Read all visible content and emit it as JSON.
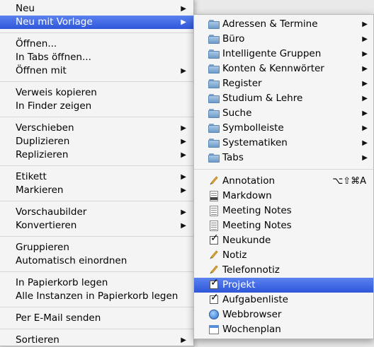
{
  "main_menu": {
    "groups": [
      [
        {
          "label": "Neu",
          "submenu": true,
          "highlight": false
        },
        {
          "label": "Neu mit Vorlage",
          "submenu": true,
          "highlight": true
        }
      ],
      [
        {
          "label": "Öffnen...",
          "submenu": false
        },
        {
          "label": "In Tabs öffnen...",
          "submenu": false
        },
        {
          "label": "Öffnen mit",
          "submenu": true
        }
      ],
      [
        {
          "label": "Verweis kopieren",
          "submenu": false
        },
        {
          "label": "In Finder zeigen",
          "submenu": false
        }
      ],
      [
        {
          "label": "Verschieben",
          "submenu": true
        },
        {
          "label": "Duplizieren",
          "submenu": true
        },
        {
          "label": "Replizieren",
          "submenu": true
        }
      ],
      [
        {
          "label": "Etikett",
          "submenu": true
        },
        {
          "label": "Markieren",
          "submenu": true
        }
      ],
      [
        {
          "label": "Vorschaubilder",
          "submenu": true
        },
        {
          "label": "Konvertieren",
          "submenu": true
        }
      ],
      [
        {
          "label": "Gruppieren",
          "submenu": false
        },
        {
          "label": "Automatisch einordnen",
          "submenu": false
        }
      ],
      [
        {
          "label": "In Papierkorb legen",
          "submenu": false
        },
        {
          "label": "Alle Instanzen in Papierkorb legen",
          "submenu": false
        }
      ],
      [
        {
          "label": "Per E-Mail senden",
          "submenu": false
        }
      ],
      [
        {
          "label": "Sortieren",
          "submenu": true
        }
      ]
    ]
  },
  "sub_menu": {
    "folders": [
      {
        "label": "Adressen & Termine",
        "icon": "folder-icon"
      },
      {
        "label": "Büro",
        "icon": "folder-icon"
      },
      {
        "label": "Intelligente Gruppen",
        "icon": "folder-icon"
      },
      {
        "label": "Konten & Kennwörter",
        "icon": "folder-icon"
      },
      {
        "label": "Register",
        "icon": "folder-icon"
      },
      {
        "label": "Studium & Lehre",
        "icon": "folder-icon"
      },
      {
        "label": "Suche",
        "icon": "folder-icon"
      },
      {
        "label": "Symbolleiste",
        "icon": "folder-icon"
      },
      {
        "label": "Systematiken",
        "icon": "folder-icon"
      },
      {
        "label": "Tabs",
        "icon": "folder-icon"
      }
    ],
    "templates": [
      {
        "label": "Annotation",
        "icon": "pencil-icon",
        "shortcut": "⌥⇧⌘A"
      },
      {
        "label": "Markdown",
        "icon": "markdown-doc-icon"
      },
      {
        "label": "Meeting Notes",
        "icon": "document-icon"
      },
      {
        "label": "Meeting Notes",
        "icon": "document-icon"
      },
      {
        "label": "Neukunde",
        "icon": "checkbox-icon"
      },
      {
        "label": "Notiz",
        "icon": "pencil-icon"
      },
      {
        "label": "Telefonnotiz",
        "icon": "pencil-icon"
      },
      {
        "label": "Projekt",
        "icon": "checkbox-icon",
        "highlight": true
      },
      {
        "label": "Aufgabenliste",
        "icon": "checkbox-icon"
      },
      {
        "label": "Webbrowser",
        "icon": "globe-icon"
      },
      {
        "label": "Wochenplan",
        "icon": "calendar-icon"
      }
    ]
  },
  "colors": {
    "highlight": "#3a63e0",
    "menu_bg": "#f4f4f4",
    "separator": "#d6d6d6"
  }
}
